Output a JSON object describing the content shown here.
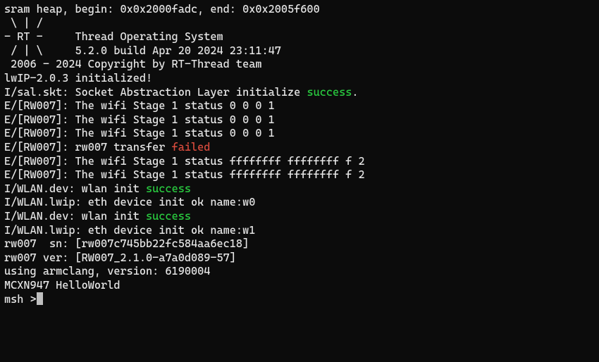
{
  "lines": [
    {
      "segments": [
        {
          "t": "sram heap, begin: 0x0x2000fadc, end: 0x0x2005f600"
        }
      ]
    },
    {
      "segments": [
        {
          "t": ""
        }
      ]
    },
    {
      "segments": [
        {
          "t": " \\ | /"
        }
      ]
    },
    {
      "segments": [
        {
          "t": "- RT -     Thread Operating System"
        }
      ]
    },
    {
      "segments": [
        {
          "t": " / | \\     5.2.0 build Apr 20 2024 23:11:47"
        }
      ]
    },
    {
      "segments": [
        {
          "t": " 2006 - 2024 Copyright by RT-Thread team"
        }
      ]
    },
    {
      "segments": [
        {
          "t": "lwIP-2.0.3 initialized!"
        }
      ]
    },
    {
      "segments": [
        {
          "t": "I/sal.skt: Socket Abstraction Layer initialize "
        },
        {
          "t": "success",
          "cls": "green"
        },
        {
          "t": "."
        }
      ]
    },
    {
      "segments": [
        {
          "t": "E/[RW007]: The wifi Stage 1 status 0 0 0 1"
        }
      ]
    },
    {
      "segments": [
        {
          "t": "E/[RW007]: The wifi Stage 1 status 0 0 0 1"
        }
      ]
    },
    {
      "segments": [
        {
          "t": "E/[RW007]: The wifi Stage 1 status 0 0 0 1"
        }
      ]
    },
    {
      "segments": [
        {
          "t": "E/[RW007]: rw007 transfer "
        },
        {
          "t": "failed",
          "cls": "red"
        }
      ]
    },
    {
      "segments": [
        {
          "t": "E/[RW007]: The wifi Stage 1 status ffffffff ffffffff f 2"
        }
      ]
    },
    {
      "segments": [
        {
          "t": "E/[RW007]: The wifi Stage 1 status ffffffff ffffffff f 2"
        }
      ]
    },
    {
      "segments": [
        {
          "t": "I/WLAN.dev: wlan init "
        },
        {
          "t": "success",
          "cls": "green"
        }
      ]
    },
    {
      "segments": [
        {
          "t": "I/WLAN.lwip: eth device init ok name:w0"
        }
      ]
    },
    {
      "segments": [
        {
          "t": "I/WLAN.dev: wlan init "
        },
        {
          "t": "success",
          "cls": "green"
        }
      ]
    },
    {
      "segments": [
        {
          "t": "I/WLAN.lwip: eth device init ok name:w1"
        }
      ]
    },
    {
      "segments": [
        {
          "t": ""
        }
      ]
    },
    {
      "segments": [
        {
          "t": "rw007  sn: [rw007c745bb22fc584aa6ec18]"
        }
      ]
    },
    {
      "segments": [
        {
          "t": "rw007 ver: [RW007_2.1.0-a7a0d089-57]"
        }
      ]
    },
    {
      "segments": [
        {
          "t": ""
        }
      ]
    },
    {
      "segments": [
        {
          "t": "using armclang, version: 6190004"
        }
      ]
    },
    {
      "segments": [
        {
          "t": "MCXN947 HelloWorld"
        }
      ]
    }
  ],
  "prompt": "msh >"
}
